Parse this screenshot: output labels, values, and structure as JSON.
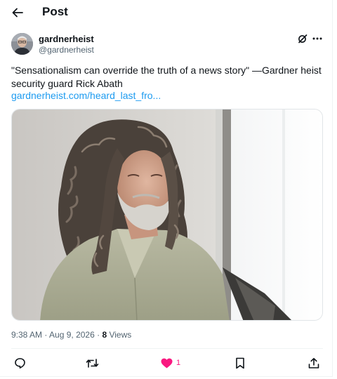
{
  "header": {
    "title": "Post"
  },
  "author": {
    "name": "gardnerheist",
    "handle": "@gardnerheist"
  },
  "tweet": {
    "text": "\"Sensationalism can override the truth of a news story\" —Gardner heist security guard Rick Abath",
    "link": "gardnerheist.com/heard_last_fro..."
  },
  "meta": {
    "time": "9:38 AM",
    "separator": " · ",
    "date": "Aug 9, 2026",
    "views_count": "8",
    "views_label": " Views"
  },
  "actions": {
    "likes": "1"
  },
  "colors": {
    "text": "#0f1419",
    "secondary": "#536471",
    "link": "#1d9bf0",
    "like": "#f91880",
    "divider": "#eff3f4"
  },
  "icons": [
    "back-arrow-icon",
    "grok-icon",
    "more-icon",
    "reply-icon",
    "repost-icon",
    "like-heart-icon",
    "bookmark-icon",
    "share-icon"
  ]
}
